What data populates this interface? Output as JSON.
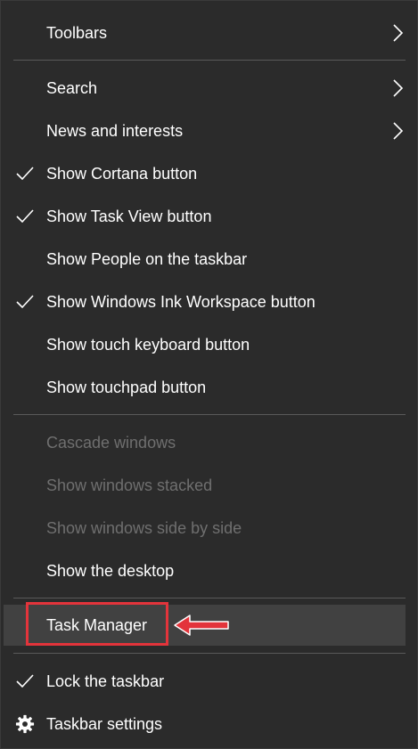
{
  "menu": {
    "items": [
      {
        "label": "Toolbars"
      },
      {
        "label": "Search"
      },
      {
        "label": "News and interests"
      },
      {
        "label": "Show Cortana button"
      },
      {
        "label": "Show Task View button"
      },
      {
        "label": "Show People on the taskbar"
      },
      {
        "label": "Show Windows Ink Workspace button"
      },
      {
        "label": "Show touch keyboard button"
      },
      {
        "label": "Show touchpad button"
      },
      {
        "label": "Cascade windows"
      },
      {
        "label": "Show windows stacked"
      },
      {
        "label": "Show windows side by side"
      },
      {
        "label": "Show the desktop"
      },
      {
        "label": "Task Manager"
      },
      {
        "label": "Lock the taskbar"
      },
      {
        "label": "Taskbar settings"
      }
    ]
  },
  "checked_items": [
    "Show Cortana button",
    "Show Task View button",
    "Show Windows Ink Workspace button",
    "Lock the taskbar"
  ],
  "disabled_items": [
    "Cascade windows",
    "Show windows stacked",
    "Show windows side by side"
  ],
  "highlighted_item": "Task Manager",
  "icons": {
    "check": "checkmark-icon",
    "submenu": "chevron-right-icon",
    "settings": "gear-icon",
    "annotation": "red-arrow-icon"
  },
  "colors": {
    "background": "#2b2b2b",
    "text": "#ffffff",
    "disabled_text": "#6f6f6f",
    "hover": "#414141",
    "separator": "#5a5a5a",
    "annotation": "#e3343b"
  }
}
